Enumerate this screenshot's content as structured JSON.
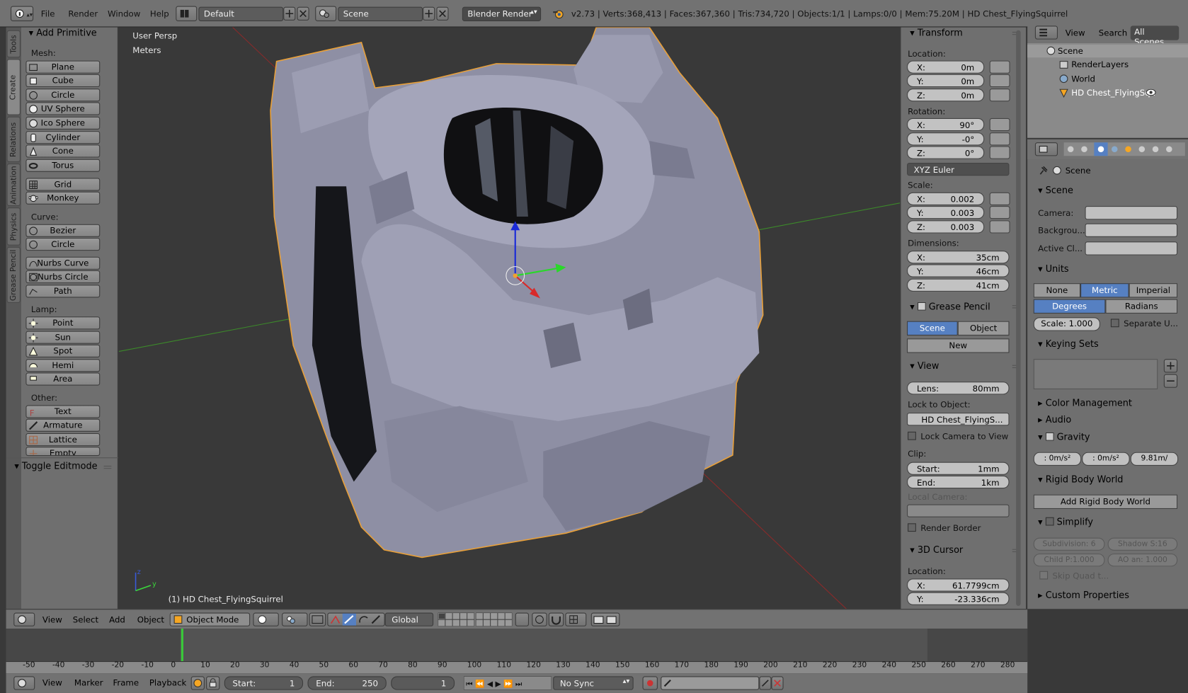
{
  "topbar": {
    "menus": [
      "File",
      "Render",
      "Window",
      "Help"
    ],
    "layout": "Default",
    "scene": "Scene",
    "engine": "Blender Render",
    "info": "v2.73 | Verts:368,413 | Faces:367,360 | Tris:734,720 | Objects:1/1 | Lamps:0/0 | Mem:75.20M | HD Chest_FlyingSquirrel"
  },
  "left_tabs": [
    "Tools",
    "Create",
    "Relations",
    "Animation",
    "Physics",
    "Grease Pencil"
  ],
  "toolshelf": {
    "title": "Add Primitive",
    "mesh_label": "Mesh:",
    "mesh": [
      "Plane",
      "Cube",
      "Circle",
      "UV Sphere",
      "Ico Sphere",
      "Cylinder",
      "Cone",
      "Torus"
    ],
    "mesh2": [
      "Grid",
      "Monkey"
    ],
    "curve_label": "Curve:",
    "curve": [
      "Bezier",
      "Circle"
    ],
    "curve2": [
      "Nurbs Curve",
      "Nurbs Circle",
      "Path"
    ],
    "lamp_label": "Lamp:",
    "lamp": [
      "Point",
      "Sun",
      "Spot",
      "Hemi",
      "Area"
    ],
    "other_label": "Other:",
    "other": [
      "Text",
      "Armature",
      "Lattice",
      "Empty"
    ],
    "toggle": "Toggle Editmode"
  },
  "viewport": {
    "persp": "User Persp",
    "units": "Meters",
    "object_label": "(1) HD Chest_FlyingSquirrel"
  },
  "npanel": {
    "transform": "Transform",
    "location_label": "Location:",
    "location": [
      [
        "X:",
        "0m"
      ],
      [
        "Y:",
        "0m"
      ],
      [
        "Z:",
        "0m"
      ]
    ],
    "rotation_label": "Rotation:",
    "rotation": [
      [
        "X:",
        "90°"
      ],
      [
        "Y:",
        "-0°"
      ],
      [
        "Z:",
        "0°"
      ]
    ],
    "rotation_mode": "XYZ Euler",
    "scale_label": "Scale:",
    "scale": [
      [
        "X:",
        "0.002"
      ],
      [
        "Y:",
        "0.003"
      ],
      [
        "Z:",
        "0.003"
      ]
    ],
    "dimensions_label": "Dimensions:",
    "dimensions": [
      [
        "X:",
        "35cm"
      ],
      [
        "Y:",
        "46cm"
      ],
      [
        "Z:",
        "41cm"
      ]
    ],
    "grease_pencil": "Grease Pencil",
    "gp_scene": "Scene",
    "gp_object": "Object",
    "gp_new": "New",
    "view": "View",
    "lens_k": "Lens:",
    "lens_v": "80mm",
    "lock_to_object": "Lock to Object:",
    "lock_object_name": "HD Chest_FlyingS...",
    "lock_camera": "Lock Camera to View",
    "clip": "Clip:",
    "clip_start": [
      "Start:",
      "1mm"
    ],
    "clip_end": [
      "End:",
      "1km"
    ],
    "local_camera": "Local Camera:",
    "render_border": "Render Border",
    "cursor": "3D Cursor",
    "cursor_location": "Location:",
    "cursor_x": [
      "X:",
      "61.7799cm"
    ],
    "cursor_y": [
      "Y:",
      "-23.336cm"
    ]
  },
  "outliner": {
    "menus": [
      "View",
      "Search"
    ],
    "scenes": "All Scenes",
    "tree": [
      "Scene",
      "RenderLayers",
      "World",
      "HD Chest_FlyingSqu"
    ]
  },
  "props": {
    "context": "Scene",
    "scene_panel": "Scene",
    "camera": "Camera:",
    "background": "Backgrou...",
    "active_clip": "Active Cl...",
    "units": "Units",
    "unit_opts": [
      "None",
      "Metric",
      "Imperial"
    ],
    "angle_opts": [
      "Degrees",
      "Radians"
    ],
    "scale": "Scale: 1.000",
    "separate": "Separate U...",
    "keying": "Keying Sets",
    "color_mgmt": "Color Management",
    "audio": "Audio",
    "gravity": "Gravity",
    "gravity_vals": [
      ": 0m/s²",
      ": 0m/s²",
      "9.81m/"
    ],
    "rigid": "Rigid Body World",
    "add_rigid": "Add Rigid Body World",
    "simplify": "Simplify",
    "simplify_vals": [
      "Subdivision: 6",
      "Shadow S:16",
      "Child P:1.000",
      "AO an: 1.000"
    ],
    "skip_quad": "Skip Quad t...",
    "custom": "Custom Properties"
  },
  "vp_header": {
    "menus": [
      "View",
      "Select",
      "Add",
      "Object"
    ],
    "mode": "Object Mode",
    "orientation": "Global"
  },
  "timeline": {
    "ruler": [
      "-50",
      "-40",
      "-30",
      "-20",
      "-10",
      "0",
      "10",
      "20",
      "30",
      "40",
      "50",
      "60",
      "70",
      "80",
      "90",
      "100",
      "110",
      "120",
      "130",
      "140",
      "150",
      "160",
      "170",
      "180",
      "190",
      "200",
      "210",
      "220",
      "230",
      "240",
      "250",
      "260",
      "270",
      "280"
    ],
    "menus": [
      "View",
      "Marker",
      "Frame",
      "Playback"
    ],
    "start": [
      "Start:",
      "1"
    ],
    "end": [
      "End:",
      "250"
    ],
    "current": "1",
    "sync": "No Sync"
  }
}
